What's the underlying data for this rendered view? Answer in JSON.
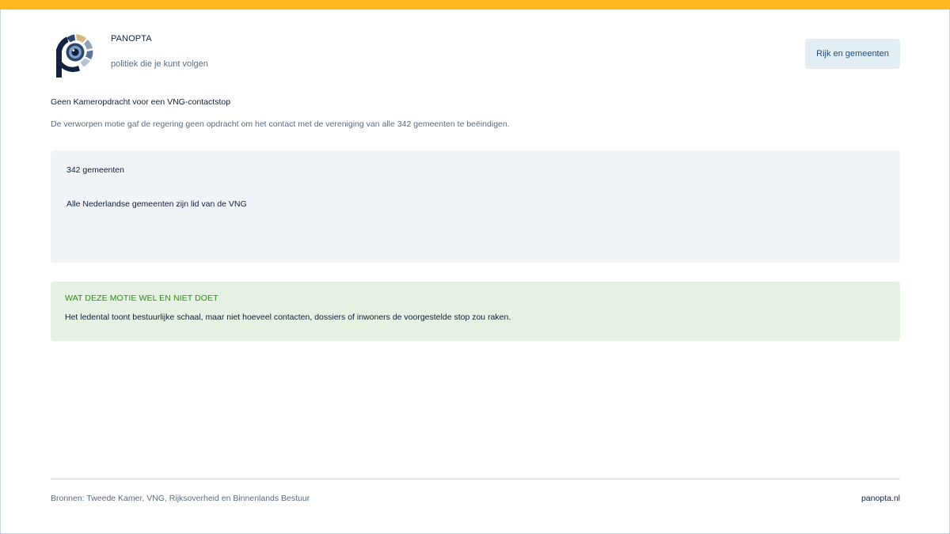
{
  "colors": {
    "accent_bar": "#fbb91f",
    "brand_navy": "#10223f",
    "note_heading": "#2f8a16",
    "note_background": "#e5f1e3",
    "card_background": "#f1f4f7",
    "button_background": "#e3edf4"
  },
  "header": {
    "logo_icon": "panopta-eye-logo-icon",
    "brand_name": "PANOPTA",
    "tagline": "politiek die je kunt volgen",
    "nav_button_label": "Rijk en gemeenten"
  },
  "main": {
    "headline": "Geen Kameropdracht voor een VNG-contactstop",
    "summary": "De verworpen motie gaf de regering geen opdracht om het contact met de vereniging van alle 342 gemeenten te beëindigen.",
    "fact_card": {
      "number_label": "342 gemeenten",
      "text": "Alle Nederlandse gemeenten zijn lid van de VNG"
    },
    "note": {
      "heading": "WAT DEZE MOTIE WEL EN NIET DOET",
      "text": "Het ledental toont bestuurlijke schaal, maar niet hoeveel contacten, dossiers of inwoners de voorgestelde stop zou raken."
    }
  },
  "footer": {
    "sources": "Bronnen: Tweede Kamer, VNG, Rijksoverheid en Binnenlands Bestuur",
    "site": "panopta.nl"
  }
}
